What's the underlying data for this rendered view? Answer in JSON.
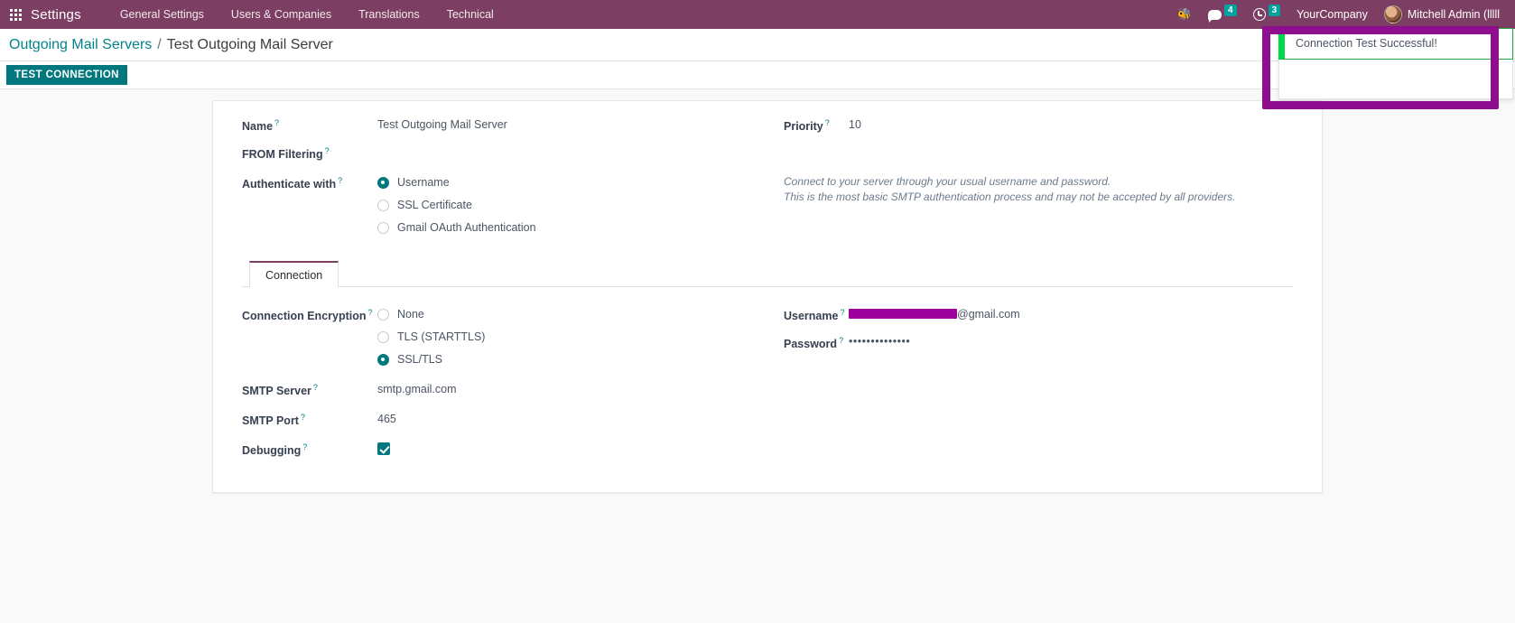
{
  "navbar": {
    "apps_icon": "apps-grid-icon",
    "brand": "Settings",
    "menu": [
      {
        "label": "General Settings"
      },
      {
        "label": "Users & Companies"
      },
      {
        "label": "Translations"
      },
      {
        "label": "Technical"
      }
    ],
    "systray": {
      "bug_icon": "bug-icon",
      "messages_icon": "chat-bubble-icon",
      "messages_count": "4",
      "activities_icon": "clock-icon",
      "activities_count": "3",
      "company": "YourCompany",
      "user": "Mitchell Admin (lllll",
      "avatar": "user-avatar"
    }
  },
  "breadcrumb": {
    "root": "Outgoing Mail Servers",
    "separator": "/",
    "current": "Test Outgoing Mail Server"
  },
  "action_bar": {
    "test_connection": "TEST CONNECTION"
  },
  "notification": {
    "message": "Connection Test Successful!",
    "accent_color": "#00d64a",
    "border_color": "#28a745",
    "annotation_color": "#8f0e8f"
  },
  "form": {
    "help_marker": "?",
    "name": {
      "label": "Name",
      "value": "Test Outgoing Mail Server"
    },
    "from_filtering": {
      "label": "FROM Filtering",
      "value": ""
    },
    "priority": {
      "label": "Priority",
      "value": "10"
    },
    "authenticate_with": {
      "label": "Authenticate with",
      "options": [
        {
          "label": "Username",
          "selected": true
        },
        {
          "label": "SSL Certificate",
          "selected": false
        },
        {
          "label": "Gmail OAuth Authentication",
          "selected": false
        }
      ],
      "hint_line1": "Connect to your server through your usual username and password.",
      "hint_line2": "This is the most basic SMTP authentication process and may not be accepted by all providers."
    }
  },
  "tabs": [
    {
      "label": "Connection",
      "active": true
    }
  ],
  "connection": {
    "encryption": {
      "label": "Connection Encryption",
      "options": [
        {
          "label": "None",
          "selected": false
        },
        {
          "label": "TLS (STARTTLS)",
          "selected": false
        },
        {
          "label": "SSL/TLS",
          "selected": true
        }
      ]
    },
    "smtp_server": {
      "label": "SMTP Server",
      "value": "smtp.gmail.com"
    },
    "smtp_port": {
      "label": "SMTP Port",
      "value": "465"
    },
    "debugging": {
      "label": "Debugging",
      "checked": true
    },
    "username": {
      "label": "Username",
      "value_redacted": true,
      "value_suffix": "@gmail.com"
    },
    "password": {
      "label": "Password",
      "value": "••••••••••••••"
    }
  },
  "colors": {
    "navbar_bg": "#7c3f63",
    "accent_teal": "#00787e",
    "link_teal": "#00848b",
    "tab_active_border": "#7c3f63"
  }
}
